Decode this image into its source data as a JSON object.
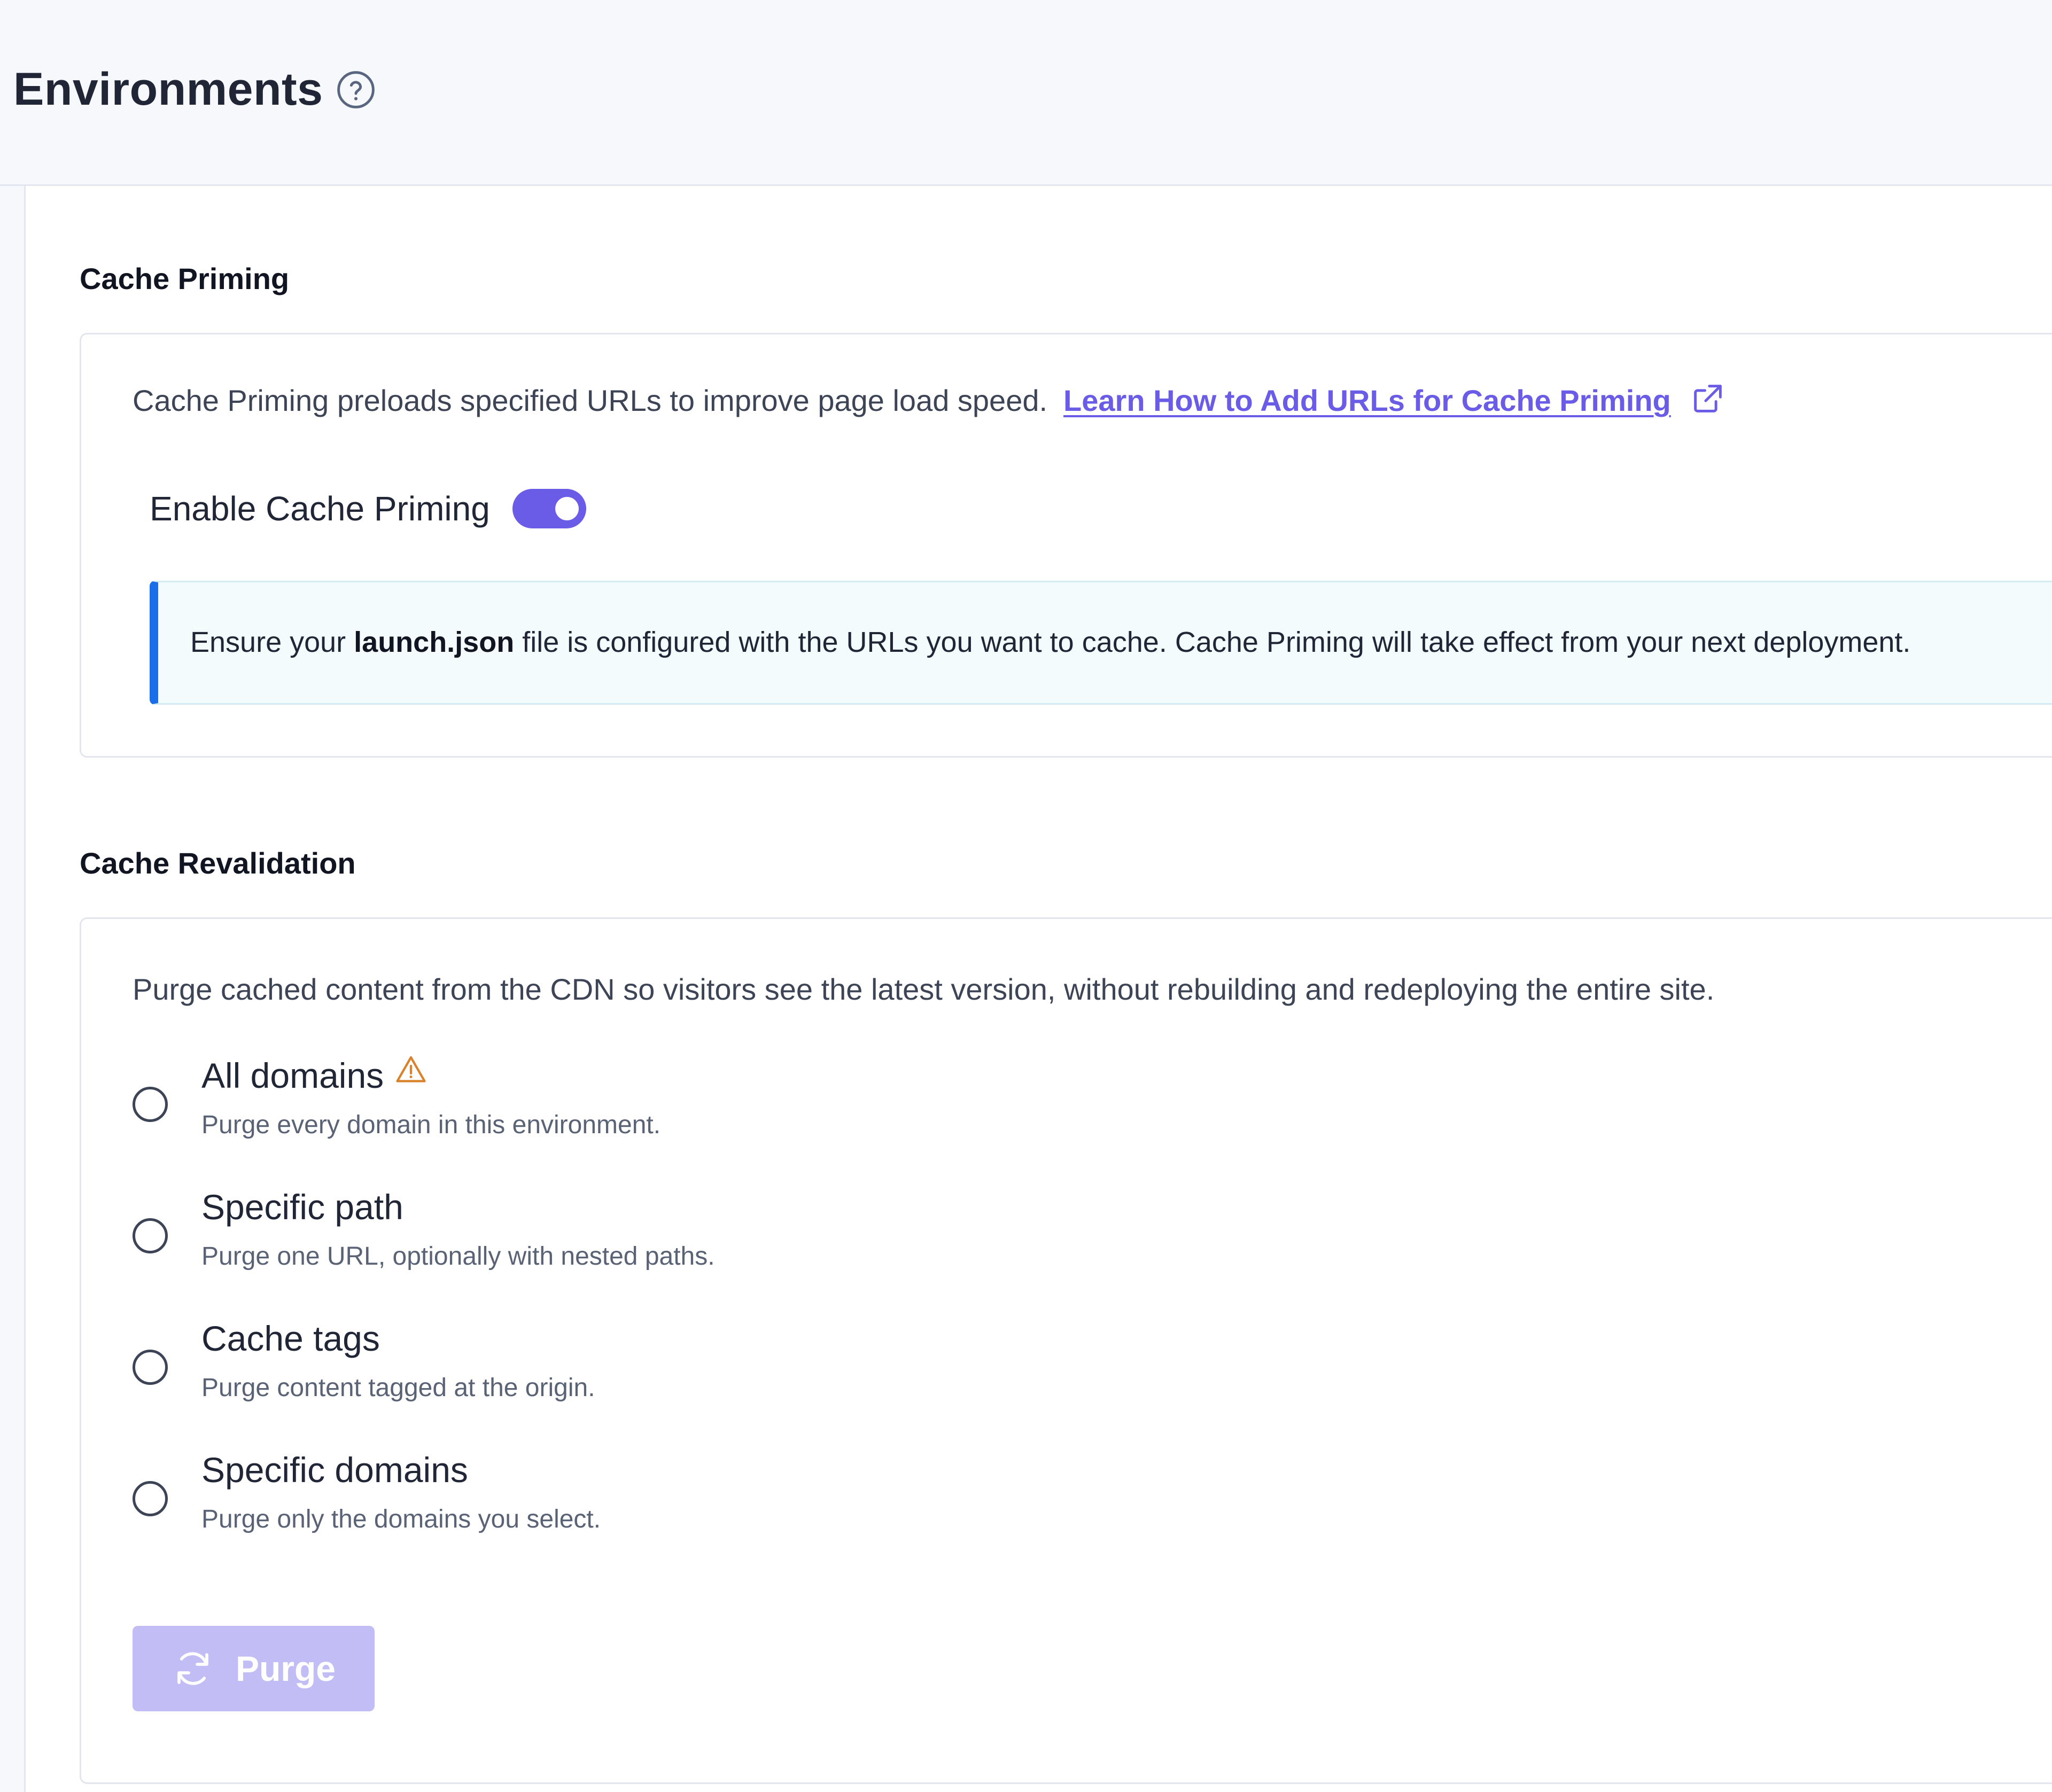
{
  "header": {
    "title": "Environments",
    "help_icon": "question-circle-icon"
  },
  "cache_priming": {
    "section_title": "Cache Priming",
    "description": "Cache Priming preloads specified URLs to improve page load speed.",
    "learn_link": "Learn How to Add URLs for Cache Priming",
    "link_icon": "external-link-icon",
    "toggle_label": "Enable Cache Priming",
    "toggle_state": "on",
    "info": {
      "prefix": "Ensure your ",
      "filename": "launch.json",
      "suffix": " file is configured with the URLs you want to cache. Cache Priming will take effect from your next deployment."
    }
  },
  "cache_revalidation": {
    "section_title": "Cache Revalidation",
    "description": "Purge cached content from the CDN so visitors see the latest version, without rebuilding and redeploying the entire site.",
    "options": [
      {
        "label": "All domains",
        "description": "Purge every domain in this environment.",
        "warning": true
      },
      {
        "label": "Specific path",
        "description": "Purge one URL, optionally with nested paths."
      },
      {
        "label": "Cache tags",
        "description": "Purge content tagged at the origin."
      },
      {
        "label": "Specific domains",
        "description": "Purge only the domains you select."
      }
    ],
    "purge_button": {
      "label": "Purge",
      "icon": "refresh-icon",
      "disabled": true
    }
  },
  "colors": {
    "accent": "#6b5ce7",
    "accent_disabled": "#c3bdf6",
    "info_border": "#1a6fe8",
    "warning": "#d9822b"
  }
}
